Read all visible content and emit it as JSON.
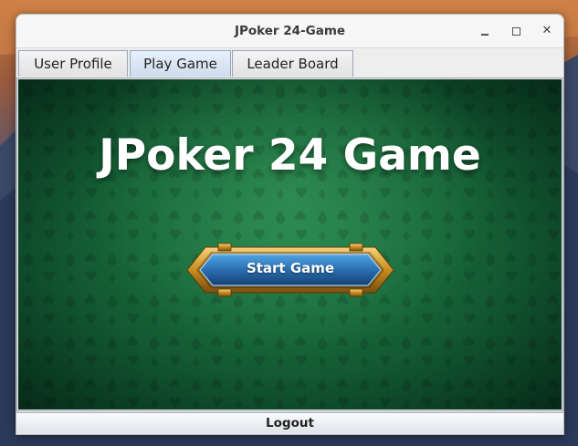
{
  "window": {
    "title": "JPoker 24-Game"
  },
  "window_controls": {
    "minimize_icon": "minimize-icon",
    "maximize_icon": "maximize-icon",
    "close_icon": "close-icon",
    "close_glyph": "✕"
  },
  "tabs": [
    {
      "label": "User Profile",
      "selected": false
    },
    {
      "label": "Play Game",
      "selected": true
    },
    {
      "label": "Leader Board",
      "selected": false
    }
  ],
  "main": {
    "heading": "JPoker 24 Game",
    "start_button_label": "Start Game"
  },
  "footer": {
    "logout_label": "Logout"
  },
  "colors": {
    "felt": "#135a33",
    "button_blue": "#2a6fb0",
    "button_gold": "#d39a2a",
    "selected_tab": "#cfdcec"
  }
}
